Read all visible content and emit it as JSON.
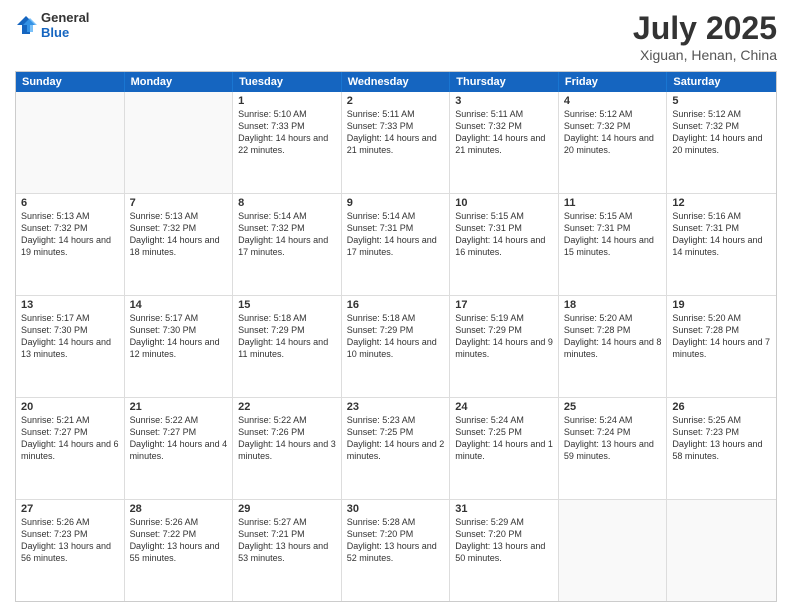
{
  "header": {
    "logo_general": "General",
    "logo_blue": "Blue",
    "month": "July 2025",
    "location": "Xiguan, Henan, China"
  },
  "weekdays": [
    "Sunday",
    "Monday",
    "Tuesday",
    "Wednesday",
    "Thursday",
    "Friday",
    "Saturday"
  ],
  "rows": [
    [
      {
        "day": "",
        "empty": true
      },
      {
        "day": "",
        "empty": true
      },
      {
        "day": "1",
        "sunrise": "5:10 AM",
        "sunset": "7:33 PM",
        "daylight": "14 hours and 22 minutes."
      },
      {
        "day": "2",
        "sunrise": "5:11 AM",
        "sunset": "7:33 PM",
        "daylight": "14 hours and 21 minutes."
      },
      {
        "day": "3",
        "sunrise": "5:11 AM",
        "sunset": "7:32 PM",
        "daylight": "14 hours and 21 minutes."
      },
      {
        "day": "4",
        "sunrise": "5:12 AM",
        "sunset": "7:32 PM",
        "daylight": "14 hours and 20 minutes."
      },
      {
        "day": "5",
        "sunrise": "5:12 AM",
        "sunset": "7:32 PM",
        "daylight": "14 hours and 20 minutes."
      }
    ],
    [
      {
        "day": "6",
        "sunrise": "5:13 AM",
        "sunset": "7:32 PM",
        "daylight": "14 hours and 19 minutes."
      },
      {
        "day": "7",
        "sunrise": "5:13 AM",
        "sunset": "7:32 PM",
        "daylight": "14 hours and 18 minutes."
      },
      {
        "day": "8",
        "sunrise": "5:14 AM",
        "sunset": "7:32 PM",
        "daylight": "14 hours and 17 minutes."
      },
      {
        "day": "9",
        "sunrise": "5:14 AM",
        "sunset": "7:31 PM",
        "daylight": "14 hours and 17 minutes."
      },
      {
        "day": "10",
        "sunrise": "5:15 AM",
        "sunset": "7:31 PM",
        "daylight": "14 hours and 16 minutes."
      },
      {
        "day": "11",
        "sunrise": "5:15 AM",
        "sunset": "7:31 PM",
        "daylight": "14 hours and 15 minutes."
      },
      {
        "day": "12",
        "sunrise": "5:16 AM",
        "sunset": "7:31 PM",
        "daylight": "14 hours and 14 minutes."
      }
    ],
    [
      {
        "day": "13",
        "sunrise": "5:17 AM",
        "sunset": "7:30 PM",
        "daylight": "14 hours and 13 minutes."
      },
      {
        "day": "14",
        "sunrise": "5:17 AM",
        "sunset": "7:30 PM",
        "daylight": "14 hours and 12 minutes."
      },
      {
        "day": "15",
        "sunrise": "5:18 AM",
        "sunset": "7:29 PM",
        "daylight": "14 hours and 11 minutes."
      },
      {
        "day": "16",
        "sunrise": "5:18 AM",
        "sunset": "7:29 PM",
        "daylight": "14 hours and 10 minutes."
      },
      {
        "day": "17",
        "sunrise": "5:19 AM",
        "sunset": "7:29 PM",
        "daylight": "14 hours and 9 minutes."
      },
      {
        "day": "18",
        "sunrise": "5:20 AM",
        "sunset": "7:28 PM",
        "daylight": "14 hours and 8 minutes."
      },
      {
        "day": "19",
        "sunrise": "5:20 AM",
        "sunset": "7:28 PM",
        "daylight": "14 hours and 7 minutes."
      }
    ],
    [
      {
        "day": "20",
        "sunrise": "5:21 AM",
        "sunset": "7:27 PM",
        "daylight": "14 hours and 6 minutes."
      },
      {
        "day": "21",
        "sunrise": "5:22 AM",
        "sunset": "7:27 PM",
        "daylight": "14 hours and 4 minutes."
      },
      {
        "day": "22",
        "sunrise": "5:22 AM",
        "sunset": "7:26 PM",
        "daylight": "14 hours and 3 minutes."
      },
      {
        "day": "23",
        "sunrise": "5:23 AM",
        "sunset": "7:25 PM",
        "daylight": "14 hours and 2 minutes."
      },
      {
        "day": "24",
        "sunrise": "5:24 AM",
        "sunset": "7:25 PM",
        "daylight": "14 hours and 1 minute."
      },
      {
        "day": "25",
        "sunrise": "5:24 AM",
        "sunset": "7:24 PM",
        "daylight": "13 hours and 59 minutes."
      },
      {
        "day": "26",
        "sunrise": "5:25 AM",
        "sunset": "7:23 PM",
        "daylight": "13 hours and 58 minutes."
      }
    ],
    [
      {
        "day": "27",
        "sunrise": "5:26 AM",
        "sunset": "7:23 PM",
        "daylight": "13 hours and 56 minutes."
      },
      {
        "day": "28",
        "sunrise": "5:26 AM",
        "sunset": "7:22 PM",
        "daylight": "13 hours and 55 minutes."
      },
      {
        "day": "29",
        "sunrise": "5:27 AM",
        "sunset": "7:21 PM",
        "daylight": "13 hours and 53 minutes."
      },
      {
        "day": "30",
        "sunrise": "5:28 AM",
        "sunset": "7:20 PM",
        "daylight": "13 hours and 52 minutes."
      },
      {
        "day": "31",
        "sunrise": "5:29 AM",
        "sunset": "7:20 PM",
        "daylight": "13 hours and 50 minutes."
      },
      {
        "day": "",
        "empty": true
      },
      {
        "day": "",
        "empty": true
      }
    ]
  ]
}
